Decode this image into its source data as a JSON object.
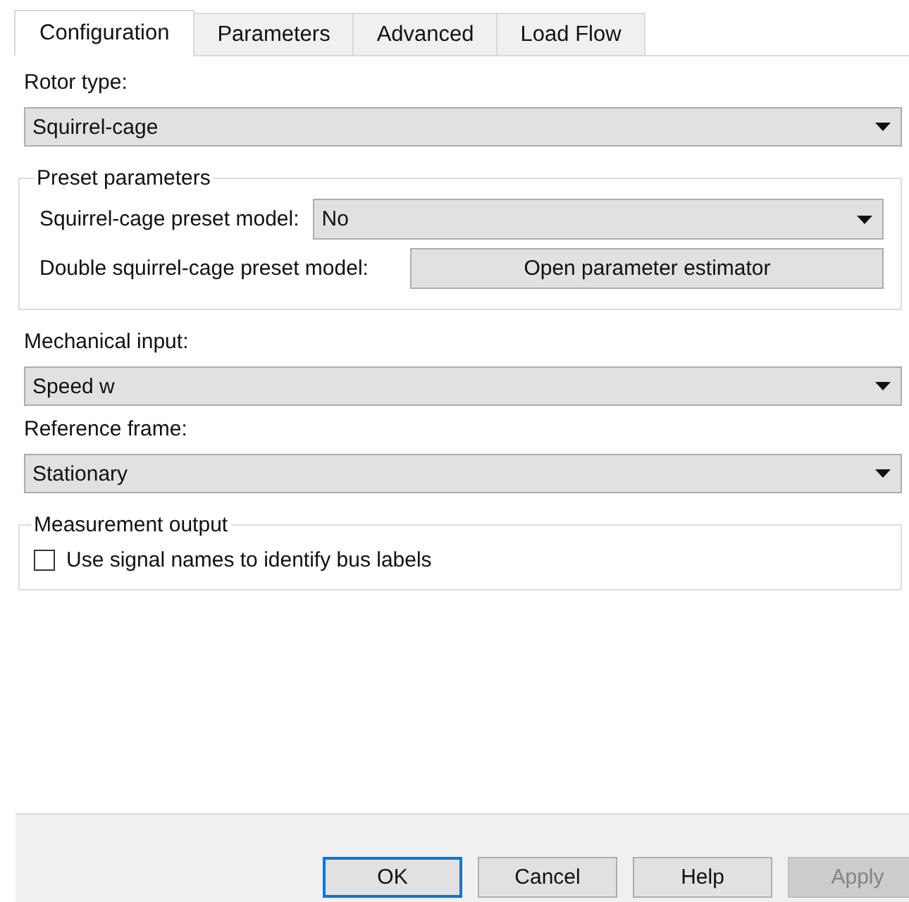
{
  "tabs": [
    {
      "label": "Configuration",
      "selected": true
    },
    {
      "label": "Parameters",
      "selected": false
    },
    {
      "label": "Advanced",
      "selected": false
    },
    {
      "label": "Load Flow",
      "selected": false
    }
  ],
  "rotor_type": {
    "label": "Rotor type:",
    "value": "Squirrel-cage"
  },
  "preset_parameters": {
    "title": "Preset parameters",
    "rows": [
      {
        "kind": "dropdown",
        "label": "Squirrel-cage preset model:",
        "value": "No"
      },
      {
        "kind": "button",
        "label": "Double squirrel-cage preset model:",
        "value": "Open parameter estimator"
      }
    ]
  },
  "mechanical_input": {
    "label": "Mechanical input:",
    "value": "Speed w"
  },
  "reference_frame": {
    "label": "Reference frame:",
    "value": "Stationary"
  },
  "measurement_output": {
    "title": "Measurement output",
    "checkbox": {
      "label": "Use signal names to identify bus labels",
      "checked": false
    }
  },
  "buttons": [
    {
      "label": "OK",
      "default": true,
      "disabled": false
    },
    {
      "label": "Cancel",
      "default": false,
      "disabled": false
    },
    {
      "label": "Help",
      "default": false,
      "disabled": false
    },
    {
      "label": "Apply",
      "default": false,
      "disabled": true
    }
  ]
}
